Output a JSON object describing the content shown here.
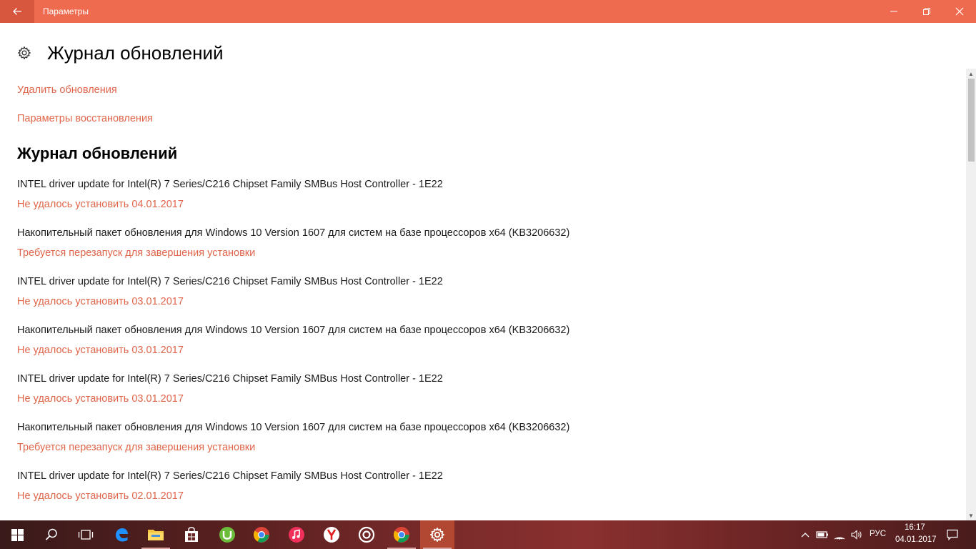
{
  "window": {
    "title": "Параметры",
    "accent": "#ef6b4f"
  },
  "page": {
    "title": "Журнал обновлений",
    "icon": "gear-icon"
  },
  "links": {
    "uninstall": "Удалить обновления",
    "recovery": "Параметры восстановления"
  },
  "section": {
    "title": "Журнал обновлений"
  },
  "updates": [
    {
      "name": "INTEL driver update for Intel(R) 7 Series/C216 Chipset Family SMBus Host Controller - 1E22",
      "status": "Не удалось установить 04.01.2017"
    },
    {
      "name": "Накопительный пакет обновления для Windows 10 Version 1607 для систем на базе процессоров x64 (KB3206632)",
      "status": "Требуется перезапуск для завершения установки"
    },
    {
      "name": "INTEL driver update for Intel(R) 7 Series/C216 Chipset Family SMBus Host Controller - 1E22",
      "status": "Не удалось установить 03.01.2017"
    },
    {
      "name": "Накопительный пакет обновления для Windows 10 Version 1607 для систем на базе процессоров x64 (KB3206632)",
      "status": "Не удалось установить 03.01.2017"
    },
    {
      "name": "INTEL driver update for Intel(R) 7 Series/C216 Chipset Family SMBus Host Controller - 1E22",
      "status": "Не удалось установить 03.01.2017"
    },
    {
      "name": "Накопительный пакет обновления для Windows 10 Version 1607 для систем на базе процессоров x64 (KB3206632)",
      "status": "Требуется перезапуск для завершения установки"
    },
    {
      "name": "INTEL driver update for Intel(R) 7 Series/C216 Chipset Family SMBus Host Controller - 1E22",
      "status": "Не удалось установить 02.01.2017"
    }
  ],
  "taskbar": {
    "apps": [
      "start-icon",
      "search-icon",
      "task-view-icon",
      "edge-icon",
      "file-explorer-icon",
      "store-icon",
      "utorrent-icon",
      "chrome-icon",
      "itunes-icon",
      "yandex-browser-icon",
      "app-circle-icon",
      "chrome-icon",
      "settings-icon"
    ],
    "language": "РУС",
    "time": "16:17",
    "date": "04.01.2017"
  }
}
